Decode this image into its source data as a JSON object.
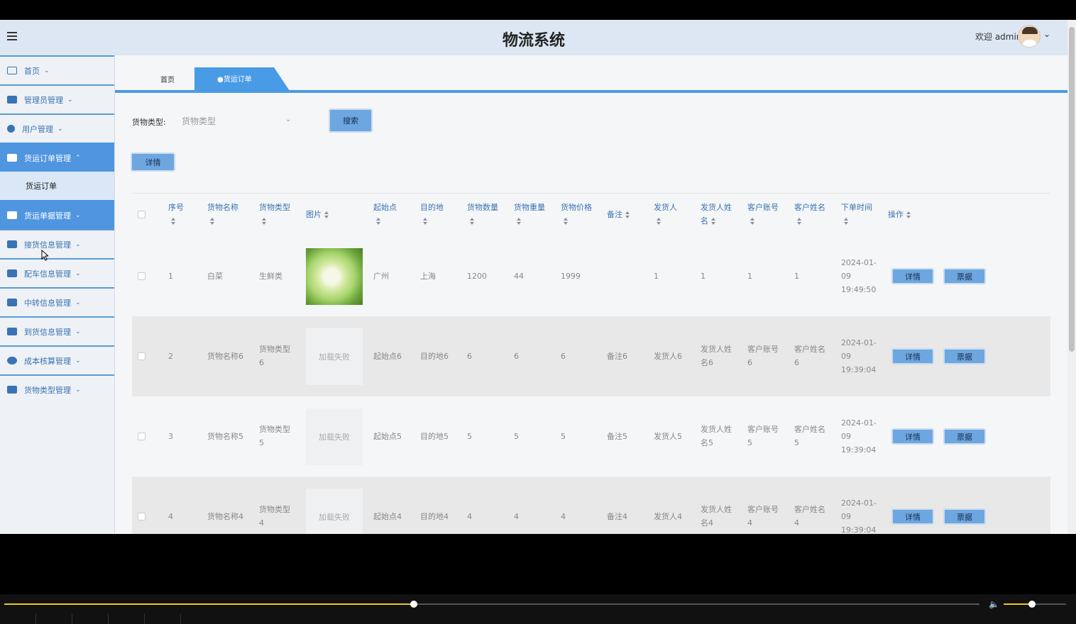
{
  "header": {
    "title": "物流系统",
    "welcome": "欢迎 admin"
  },
  "sidebar": {
    "items": [
      {
        "label": "首页",
        "icon": "home-icon"
      },
      {
        "label": "管理员管理",
        "icon": "admin-icon"
      },
      {
        "label": "用户管理",
        "icon": "user-icon"
      },
      {
        "label": "货运订单管理",
        "icon": "order-icon",
        "active": true,
        "expanded": true
      },
      {
        "label": "货运单据管理",
        "icon": "document-icon",
        "active": true
      },
      {
        "label": "接货信息管理",
        "icon": "receive-icon"
      },
      {
        "label": "配车信息管理",
        "icon": "vehicle-icon"
      },
      {
        "label": "中转信息管理",
        "icon": "transfer-icon"
      },
      {
        "label": "到货信息管理",
        "icon": "arrival-icon"
      },
      {
        "label": "成本核算管理",
        "icon": "cost-icon"
      },
      {
        "label": "货物类型管理",
        "icon": "category-icon"
      }
    ],
    "submenu": [
      "货运订单"
    ]
  },
  "tabs": {
    "home": "首页",
    "active": "●货运订单",
    "close": "×"
  },
  "search": {
    "label": "货物类型:",
    "placeholder": "货物类型",
    "button": "搜索"
  },
  "toolbar": {
    "detail_label": "详情"
  },
  "table": {
    "columns": [
      "序号",
      "货物名称",
      "货物类型",
      "图片",
      "起始点",
      "目的地",
      "货物数量",
      "货物重量",
      "货物价格",
      "备注",
      "发货人",
      "发货人姓名",
      "客户账号",
      "客户姓名",
      "下单时间",
      "操作"
    ],
    "rows": [
      {
        "idx": "1",
        "name": "白菜",
        "type": "生鲜类",
        "image": "",
        "from": "广州",
        "to": "上海",
        "qty": "1200",
        "weight": "44",
        "price": "1999",
        "note": "",
        "sender": "1",
        "sender_name": "1",
        "account": "1",
        "customer": "1",
        "time": "2024-01-09 19:49:50"
      },
      {
        "idx": "2",
        "name": "货物名称6",
        "type": "货物类型6",
        "image": "加载失败",
        "from": "起始点6",
        "to": "目的地6",
        "qty": "6",
        "weight": "6",
        "price": "6",
        "note": "备注6",
        "sender": "发货人6",
        "sender_name": "发货人姓名6",
        "account": "客户账号6",
        "customer": "客户姓名6",
        "time": "2024-01-09 19:39:04"
      },
      {
        "idx": "3",
        "name": "货物名称5",
        "type": "货物类型5",
        "image": "加载失败",
        "from": "起始点5",
        "to": "目的地5",
        "qty": "5",
        "weight": "5",
        "price": "5",
        "note": "备注5",
        "sender": "发货人5",
        "sender_name": "发货人姓名5",
        "account": "客户账号5",
        "customer": "客户姓名5",
        "time": "2024-01-09 19:39:04"
      },
      {
        "idx": "4",
        "name": "货物名称4",
        "type": "货物类型4",
        "image": "加载失败",
        "from": "起始点4",
        "to": "目的地4",
        "qty": "4",
        "weight": "4",
        "price": "4",
        "note": "备注4",
        "sender": "发货人4",
        "sender_name": "发货人姓名4",
        "account": "客户账号4",
        "customer": "客户姓名4",
        "time": "2024-01-09 19:39:04"
      }
    ],
    "row_actions": {
      "detail": "详情",
      "ticket": "票据"
    }
  },
  "player": {
    "progress": 0.42,
    "volume": 0.45
  }
}
